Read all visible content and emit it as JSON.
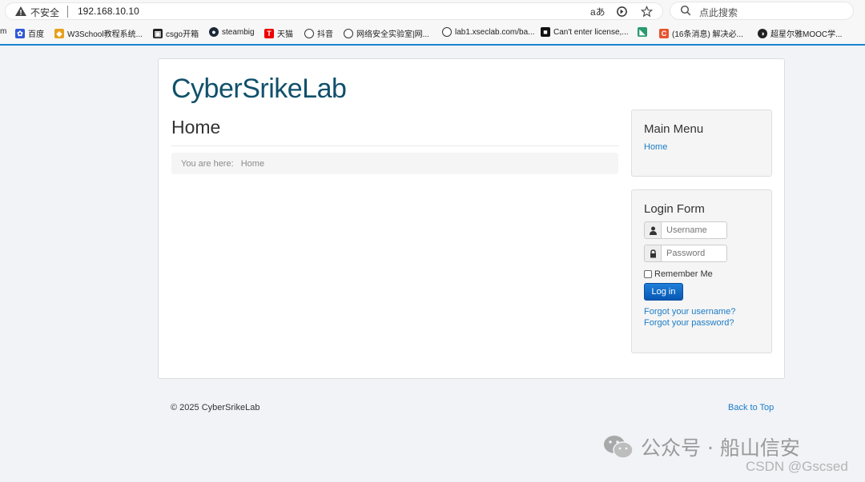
{
  "browser": {
    "security_label": "不安全",
    "url": "192.168.10.10",
    "search_placeholder": "点此搜索",
    "bookmarks": [
      {
        "label": "m"
      },
      {
        "label": "百度"
      },
      {
        "label": "W3School教程系统..."
      },
      {
        "label": "csgo开箱"
      },
      {
        "label": "steambig"
      },
      {
        "label": "天猫"
      },
      {
        "label": "抖音"
      },
      {
        "label": "网络安全实验室|网..."
      },
      {
        "label": "lab1.xseclab.com/ba..."
      },
      {
        "label": "Can't enter license,..."
      },
      {
        "label": ""
      },
      {
        "label": "(16条消息) 解决必..."
      },
      {
        "label": "超星尔雅MOOC学..."
      }
    ]
  },
  "site": {
    "brand": "CyberSrikeLab",
    "page_title": "Home",
    "breadcrumb": {
      "prefix": "You are here:",
      "current": "Home"
    }
  },
  "menu_module": {
    "title": "Main Menu",
    "items": [
      "Home"
    ]
  },
  "login_module": {
    "title": "Login Form",
    "username_placeholder": "Username",
    "password_placeholder": "Password",
    "remember_label": "Remember Me",
    "login_label": "Log in",
    "forgot_username": "Forgot your username?",
    "forgot_password": "Forgot your password?"
  },
  "footer": {
    "copyright": "© 2025 CyberSrikeLab",
    "back_to_top": "Back to Top"
  },
  "watermark": {
    "text": "公众号 · 船山信安",
    "csdn": "CSDN @Gscsed"
  },
  "colors": {
    "brand": "#10506b",
    "link": "#1b7cc5",
    "button": "#0758b5",
    "chrome_accent": "#1a86d0"
  }
}
